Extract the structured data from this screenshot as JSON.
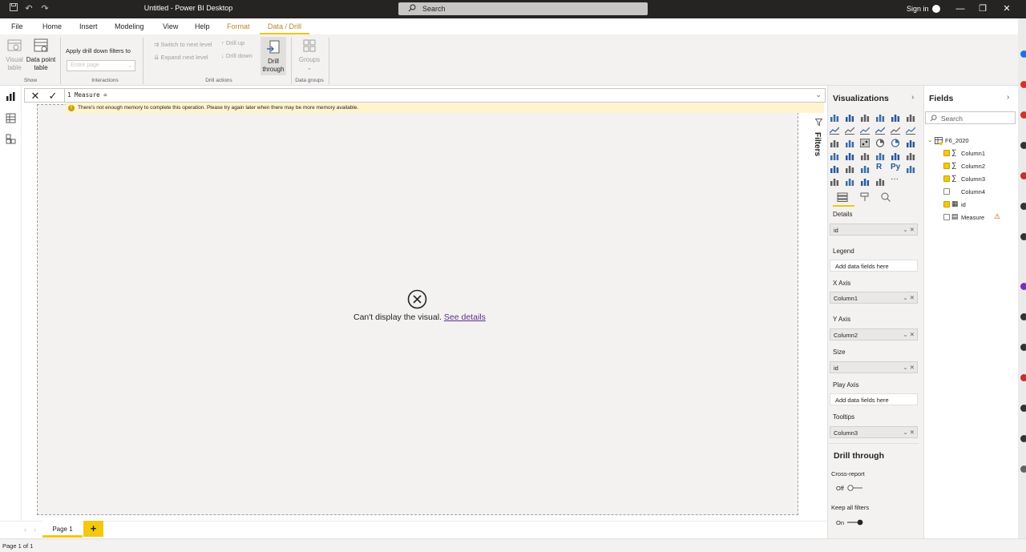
{
  "titlebar": {
    "title": "Untitled - Power BI Desktop",
    "search_placeholder": "Search",
    "signin": "Sign in"
  },
  "menu": {
    "tabs": [
      "File",
      "Home",
      "Insert",
      "Modeling",
      "View",
      "Help",
      "Format",
      "Data / Drill"
    ],
    "active_tab": "Data / Drill"
  },
  "ribbon": {
    "show": {
      "visual_table": [
        "Visual",
        "table"
      ],
      "data_point_table": [
        "Data point",
        "table"
      ],
      "label": "Show"
    },
    "interactions": {
      "apply_drill_label": "Apply drill down filters to",
      "apply_drill_value": "Entire page",
      "label": "Interactions"
    },
    "drill_actions": {
      "switch_next": "Switch to next level",
      "expand_next": "Expand next level",
      "drill_up": "Drill up",
      "drill_down": "Drill down",
      "drill_through": [
        "Drill",
        "through"
      ],
      "label": "Drill actions"
    },
    "data_groups": {
      "groups": "Groups",
      "label": "Data groups"
    }
  },
  "formula": {
    "text": "1  Measure =",
    "warning": "There's not enough memory to complete this operation. Please try again later when there may be more memory available."
  },
  "visual": {
    "error_text": "Can't display the visual.",
    "error_link": "See details"
  },
  "filters": {
    "label": "Filters"
  },
  "visualizations": {
    "title": "Visualizations",
    "wells": {
      "details_label": "Details",
      "details_value": "id",
      "legend_label": "Legend",
      "legend_value": "Add data fields here",
      "xaxis_label": "X Axis",
      "xaxis_value": "Column1",
      "yaxis_label": "Y Axis",
      "yaxis_value": "Column2",
      "size_label": "Size",
      "size_value": "id",
      "playaxis_label": "Play Axis",
      "playaxis_value": "Add data fields here",
      "tooltips_label": "Tooltips",
      "tooltips_value": "Column3"
    },
    "drill_through": {
      "title": "Drill through",
      "cross_report_label": "Cross-report",
      "cross_report_state": "Off",
      "keep_filters_label": "Keep all filters",
      "keep_filters_state": "On"
    },
    "r_glyph": "R",
    "py_glyph": "Py",
    "more_glyph": "···"
  },
  "fields": {
    "title": "Fields",
    "search_placeholder": "Search",
    "table_name": "F6_2020",
    "items": [
      {
        "name": "Column1",
        "checked": true,
        "type": "sigma"
      },
      {
        "name": "Column2",
        "checked": true,
        "type": "sigma"
      },
      {
        "name": "Column3",
        "checked": true,
        "type": "sigma"
      },
      {
        "name": "Column4",
        "checked": false,
        "type": "none"
      },
      {
        "name": "id",
        "checked": true,
        "type": "table"
      },
      {
        "name": "Measure",
        "checked": false,
        "type": "calc",
        "warning": true
      }
    ]
  },
  "pages": {
    "page1": "Page 1",
    "add": "+"
  },
  "status": {
    "text": "Page 1 of 1"
  },
  "colors": {
    "accent": "#f2c811",
    "titlebar": "#252423",
    "link": "#5b2f91",
    "warning_bg": "#fff4ce"
  }
}
